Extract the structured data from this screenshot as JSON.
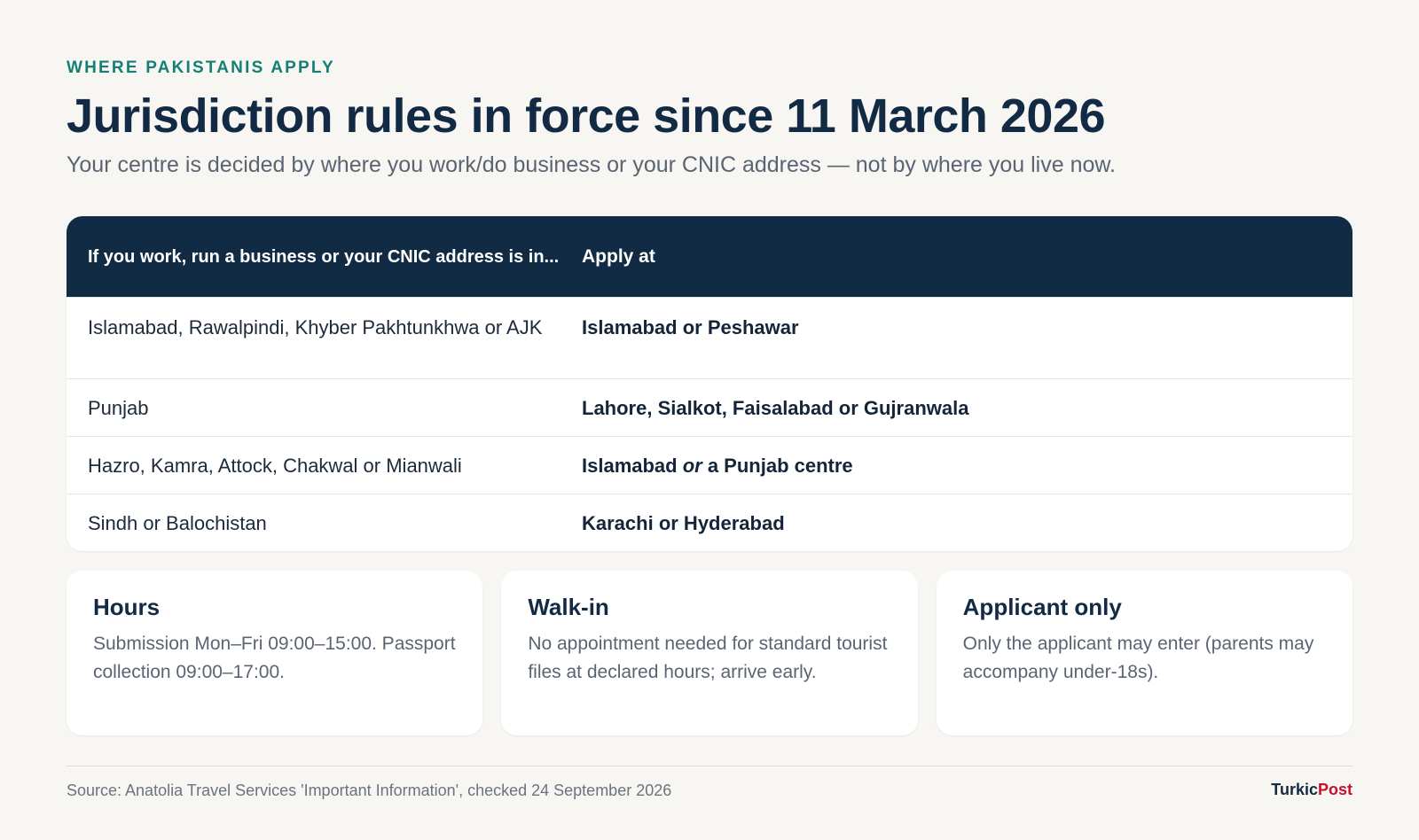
{
  "header": {
    "kicker": "WHERE PAKISTANIS APPLY",
    "title": "Jurisdiction rules in force since 11 March 2026",
    "subtitle": "Your centre is decided by where you work/do business or your CNIC address — not by where you live now."
  },
  "table": {
    "columns": [
      "If you work, run a business or your CNIC address is in...",
      "Apply at"
    ],
    "rows": [
      {
        "region": "Islamabad, Rawalpindi, Khyber Pakhtunkhwa or AJK",
        "centre": "Islamabad or Peshawar"
      },
      {
        "region": "Punjab",
        "centre": "Lahore, Sialkot, Faisalabad or Gujranwala"
      },
      {
        "region": "Hazro, Kamra, Attock, Chakwal or Mianwali",
        "centre_a": "Islamabad ",
        "centre_or": "or",
        "centre_b": " a Punjab centre"
      },
      {
        "region": "Sindh or Balochistan",
        "centre": "Karachi or Hyderabad"
      }
    ]
  },
  "cards": [
    {
      "title": "Hours",
      "text": "Submission Mon–Fri 09:00–15:00. Passport collection 09:00–17:00."
    },
    {
      "title": "Walk-in",
      "text": "No appointment needed for standard tourist files at declared hours; arrive early."
    },
    {
      "title": "Applicant only",
      "text": "Only the applicant may enter (parents may accompany under-18s)."
    }
  ],
  "footer": {
    "source": "Source: Anatolia Travel Services 'Important Information', checked 24 September 2026",
    "brand_part1": "Turkic",
    "brand_part2": "Post"
  },
  "colors": {
    "accent": "#157f76",
    "header_bg": "#112b45",
    "brand_red": "#c8102e"
  }
}
